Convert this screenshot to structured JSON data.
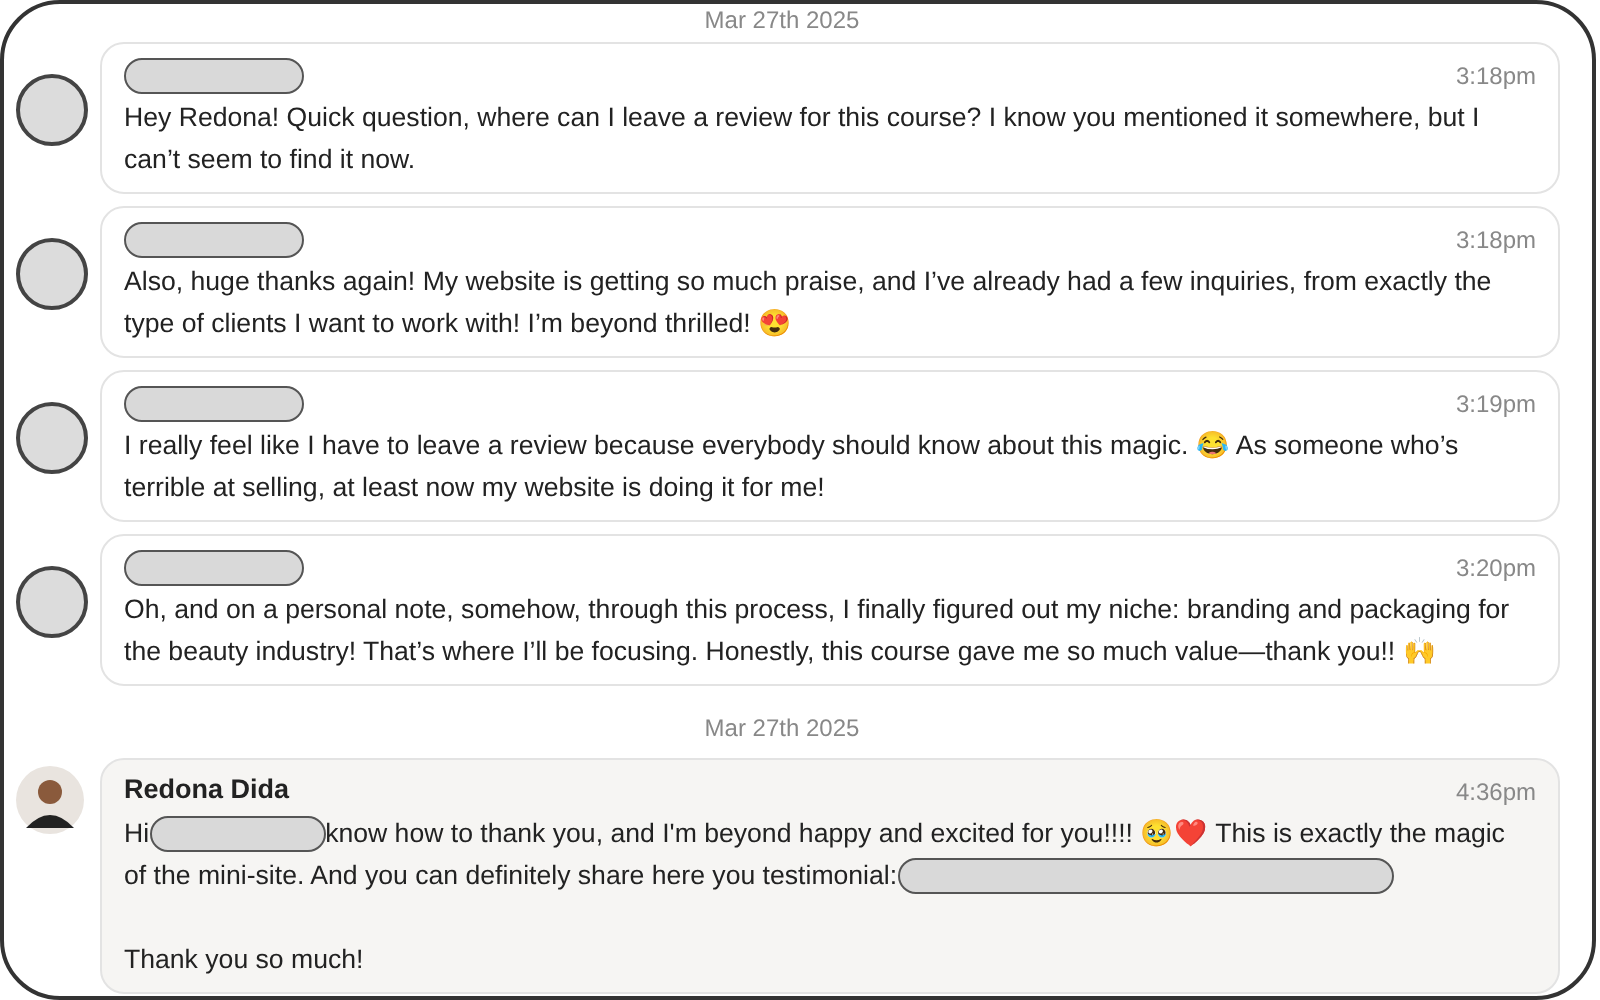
{
  "timeline": [
    {
      "kind": "date",
      "text": "Mar 27th 2025"
    },
    {
      "kind": "message",
      "own": false,
      "time": "3:18pm",
      "paragraphs": [
        [
          {
            "kind": "text",
            "text": "Hey Redona! Quick question, where can I leave a review for this course? I know you mentioned it somewhere, but I can’t seem to find it now."
          }
        ]
      ]
    },
    {
      "kind": "message",
      "own": false,
      "time": "3:18pm",
      "paragraphs": [
        [
          {
            "kind": "text",
            "text": "Also, huge thanks again! My website is getting so much praise, and I’ve already had a few inquiries, from exactly the type of clients I want to work with! I’m beyond thrilled! 😍"
          }
        ]
      ]
    },
    {
      "kind": "message",
      "own": false,
      "time": "3:19pm",
      "paragraphs": [
        [
          {
            "kind": "text",
            "text": "I really feel like I have to leave a review because everybody should know about this magic. 😂 As someone who’s terrible at selling, at least now my website is doing it for me!"
          }
        ]
      ]
    },
    {
      "kind": "message",
      "own": false,
      "time": "3:20pm",
      "paragraphs": [
        [
          {
            "kind": "text",
            "text": "Oh, and on a personal note, somehow, through this process, I finally figured out my niche: branding and packaging for the beauty industry! That’s where I’ll be focusing. Honestly, this course gave me so much value—thank you!! 🙌"
          }
        ]
      ]
    },
    {
      "kind": "date",
      "text": "Mar 27th 2025"
    },
    {
      "kind": "message",
      "author": "Redona Dida",
      "own": true,
      "time": "4:36pm",
      "paragraphs": [
        [
          {
            "kind": "text",
            "text": "Hi"
          },
          {
            "kind": "redaction"
          },
          {
            "kind": "text",
            "text": "know how to thank you, and I'm beyond happy and excited for you!!!! 🥹❤️ This is exactly the magic"
          },
          {
            "kind": "text",
            "text": "of the mini-site. And you can definitely share here you testimonial:"
          },
          {
            "kind": "redaction"
          }
        ],
        [
          {
            "kind": "text",
            "text": "Thank you so much!"
          }
        ]
      ]
    }
  ]
}
